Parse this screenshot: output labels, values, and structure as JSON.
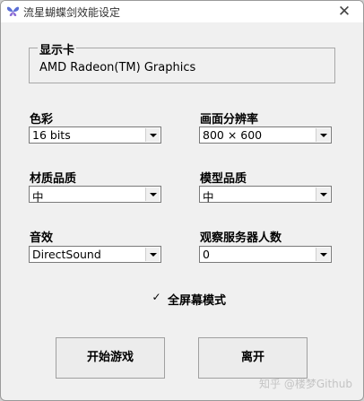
{
  "window": {
    "title": "流星蝴蝶剑效能设定",
    "close_label": "✕"
  },
  "graphics_card": {
    "label": "显示卡",
    "value": "AMD Radeon(TM) Graphics"
  },
  "color": {
    "label": "色彩",
    "value": "16 bits"
  },
  "resolution": {
    "label": "画面分辨率",
    "value": "800 × 600"
  },
  "material_quality": {
    "label": "材质品质",
    "value": "中"
  },
  "model_quality": {
    "label": "模型品质",
    "value": "中"
  },
  "sound": {
    "label": "音效",
    "value": "DirectSound"
  },
  "observer_server_count": {
    "label": "观察服务器人数",
    "value": "0"
  },
  "fullscreen": {
    "label": "全屏幕模式",
    "checked": true,
    "mark": "✓"
  },
  "buttons": {
    "start_game": "开始游戏",
    "leave": "离开"
  },
  "watermark": "知乎 @楼梦Github"
}
